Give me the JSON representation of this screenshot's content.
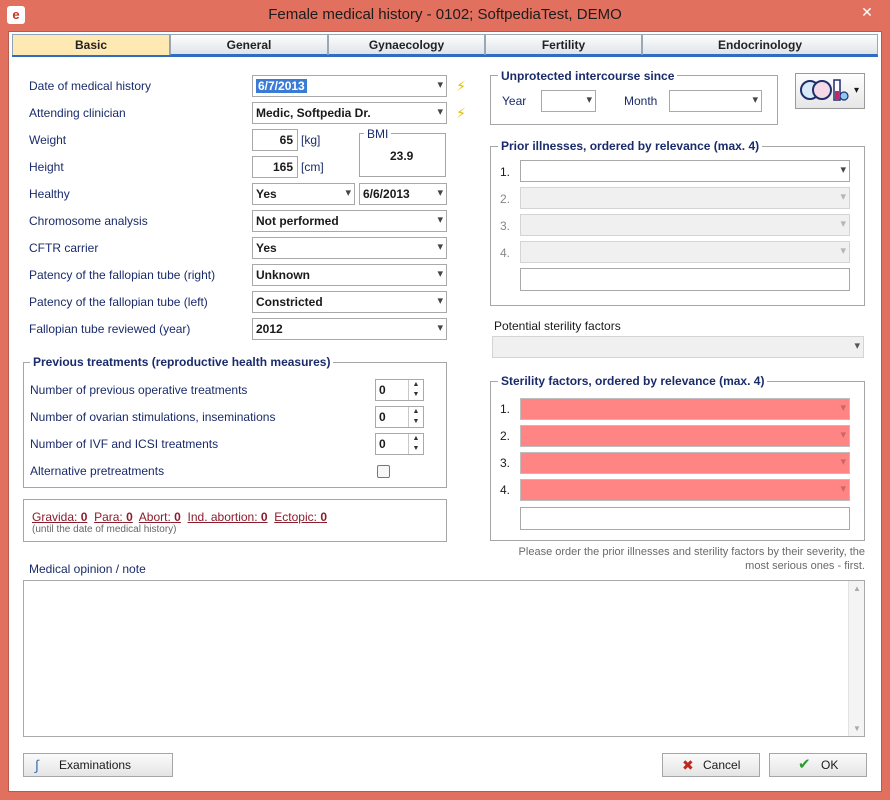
{
  "window": {
    "title": "Female medical history - 0102; SoftpediaTest, DEMO",
    "close_glyph": "✕",
    "app_icon": "e-icon"
  },
  "tabs": [
    "Basic",
    "General",
    "Gynaecology",
    "Fertility",
    "Endocrinology"
  ],
  "left_fields": {
    "date_label": "Date of medical history",
    "date_value": "6/7/2013",
    "clinician_label": "Attending clinician",
    "clinician_value": "Medic, Softpedia Dr.",
    "weight_label": "Weight",
    "weight_value": "65",
    "weight_unit": "[kg]",
    "height_label": "Height",
    "height_value": "165",
    "height_unit": "[cm]",
    "bmi_label": "BMI",
    "bmi_value": "23.9",
    "healthy_label": "Healthy",
    "healthy_value": "Yes",
    "healthy_date": "6/6/2013",
    "chromosome_label": "Chromosome analysis",
    "chromosome_value": "Not performed",
    "cftr_label": "CFTR carrier",
    "cftr_value": "Yes",
    "tube_right_label": "Patency of the fallopian tube (right)",
    "tube_right_value": "Unknown",
    "tube_left_label": "Patency of the fallopian tube (left)",
    "tube_left_value": "Constricted",
    "tube_year_label": "Fallopian tube reviewed (year)",
    "tube_year_value": "2012"
  },
  "previous_treatments": {
    "title": "Previous treatments (reproductive health measures)",
    "operative_label": "Number of previous operative treatments",
    "operative_value": "0",
    "ovarian_label": "Number of ovarian stimulations, inseminations",
    "ovarian_value": "0",
    "ivf_label": "Number of IVF and ICSI treatments",
    "ivf_value": "0",
    "alternative_label": "Alternative pretreatments"
  },
  "obstetric": {
    "gravida_label": "Gravida:",
    "gravida_value": "0",
    "para_label": "Para:",
    "para_value": "0",
    "abort_label": "Abort:",
    "abort_value": "0",
    "ind_label": "Ind. abortion:",
    "ind_value": "0",
    "ectopic_label": "Ectopic:",
    "ectopic_value": "0",
    "note": "(until the date of medical history)"
  },
  "intercourse": {
    "title": "Unprotected intercourse since",
    "year_label": "Year",
    "month_label": "Month"
  },
  "prior_illnesses": {
    "title": "Prior illnesses, ordered by relevance (max. 4)",
    "numbers": [
      "1.",
      "2.",
      "3.",
      "4."
    ]
  },
  "potential_label": "Potential sterility factors",
  "sterility": {
    "title": "Sterility factors, ordered by relevance (max. 4)",
    "numbers": [
      "1.",
      "2.",
      "3.",
      "4."
    ]
  },
  "order_note_1": "Please order the prior illnesses and sterility factors by their severity, the",
  "order_note_2": "most serious ones - first.",
  "opinion_label": "Medical opinion / note",
  "buttons": {
    "examinations": "Examinations",
    "cancel": "Cancel",
    "ok": "OK"
  },
  "glyphs": {
    "arrow": "▾",
    "bolt": "⚡",
    "up": "▲",
    "down": "▼",
    "check": "✔",
    "cross": "✖"
  },
  "colors": {
    "titlebar": "#e2705f",
    "tab_active": "#ffe9b3",
    "accent": "#2f6cc2",
    "sterility_fill": "#ff8585"
  }
}
